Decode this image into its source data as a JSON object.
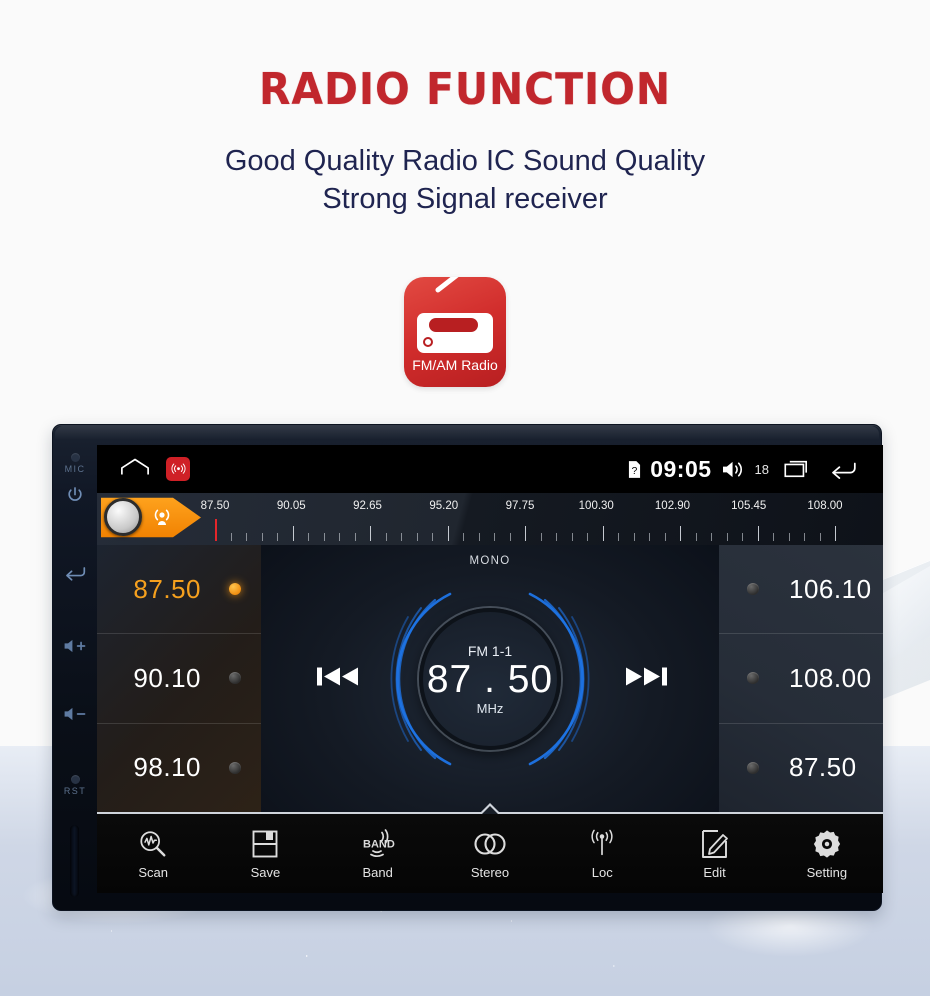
{
  "header": {
    "title": "RADIO FUNCTION",
    "subtitle_line1": "Good Quality Radio IC Sound Quality",
    "subtitle_line2": "Strong Signal receiver",
    "title_color": "#c1272d",
    "subtitle_color": "#1f2450"
  },
  "app_badge": {
    "label": "FM/AM Radio",
    "icon": "radio-icon",
    "color": "#cf2026"
  },
  "device": {
    "side_buttons": [
      {
        "name": "mic",
        "label": "MIC"
      },
      {
        "name": "power",
        "label": ""
      },
      {
        "name": "return",
        "label": ""
      },
      {
        "name": "volume-up",
        "label": ""
      },
      {
        "name": "volume-down",
        "label": ""
      },
      {
        "name": "reset",
        "label": "RST"
      }
    ]
  },
  "statusbar": {
    "home_icon": "home-icon",
    "app_icon": "radio-app-icon",
    "sim_icon": "sim-card-icon",
    "clock": "09:05",
    "volume_icon": "volume-icon",
    "volume_level": "18",
    "recents_icon": "recents-icon",
    "back_icon": "back-arrow-icon"
  },
  "tuner_scale": {
    "pennant_icon": "signal-seek-icon",
    "knob_icon": "tuning-knob",
    "tick_labels": [
      "87.50",
      "90.05",
      "92.65",
      "95.20",
      "97.75",
      "100.30",
      "102.90",
      "105.45",
      "108.00"
    ],
    "cursor_freq": "87.50",
    "range_min": 87.5,
    "range_max": 108.0
  },
  "presets_left": [
    {
      "value": "87.50",
      "active": true
    },
    {
      "value": "90.10",
      "active": false
    },
    {
      "value": "98.10",
      "active": false
    }
  ],
  "presets_right": [
    {
      "value": "106.10",
      "active": false
    },
    {
      "value": "108.00",
      "active": false
    },
    {
      "value": "87.50",
      "active": false
    }
  ],
  "dial": {
    "mode": "MONO",
    "band": "FM 1-1",
    "frequency": "87 . 50",
    "unit": "MHz",
    "prev_icon": "previous-track-icon",
    "next_icon": "next-track-icon",
    "accent": "#1a6fe0"
  },
  "toolbar": [
    {
      "label": "Scan",
      "icon": "scan-icon"
    },
    {
      "label": "Save",
      "icon": "save-icon"
    },
    {
      "label": "Band",
      "icon": "band-icon"
    },
    {
      "label": "Stereo",
      "icon": "stereo-icon"
    },
    {
      "label": "Loc",
      "icon": "local-signal-icon"
    },
    {
      "label": "Edit",
      "icon": "edit-icon"
    },
    {
      "label": "Setting",
      "icon": "settings-gear-icon"
    }
  ]
}
